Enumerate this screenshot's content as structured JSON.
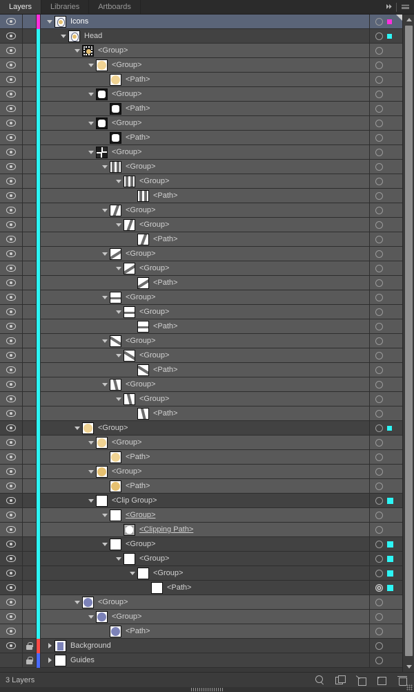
{
  "window": {
    "tabs": [
      {
        "label": "Layers",
        "active": true
      },
      {
        "label": "Libraries",
        "active": false
      },
      {
        "label": "Artboards",
        "active": false
      }
    ],
    "collapse_icon": "double-chevron-right-icon",
    "menu_icon": "panel-menu-icon"
  },
  "footer": {
    "status": "3 Layers",
    "buttons": [
      {
        "name": "locate-object-button",
        "icon": "search-icon"
      },
      {
        "name": "collect-in-new-layer-button",
        "icon": "duplicate-squares-icon"
      },
      {
        "name": "make-clipping-mask-button",
        "icon": "clipping-mask-icon"
      },
      {
        "name": "create-new-layer-button",
        "icon": "new-layer-icon"
      },
      {
        "name": "delete-selection-button",
        "icon": "trash-icon"
      }
    ]
  },
  "colors": {
    "layer_icons": "#ff2fdd",
    "layer_head": "#2df5f5",
    "layer_background": "#ff4a46",
    "layer_guides": "#4a6bff",
    "row_selected_bg": "#5a6478",
    "row_bg": "#595959",
    "row_alt_bg": "#424242",
    "swatch_gold_light": "#f0d393",
    "swatch_gold": "#e6c070",
    "swatch_periwinkle": "#7c82b8",
    "swatch_white": "#ffffff"
  },
  "rows": [
    {
      "label": "Icons",
      "indent": 0,
      "eye": true,
      "lock": false,
      "twisty": "down",
      "thumb": "face-icon-thumb",
      "color": "#ff2fdd",
      "selected": true,
      "alt": false,
      "target": "single",
      "chip": "#ff2fdd",
      "chip_size": "small",
      "underline": false
    },
    {
      "label": "Head",
      "indent": 1,
      "eye": true,
      "lock": false,
      "twisty": "down",
      "thumb": "face-icon-thumb",
      "color": "#2df5f5",
      "selected": false,
      "alt": true,
      "target": "single",
      "chip": "#2df5f5",
      "chip_size": "small",
      "underline": false
    },
    {
      "label": "<Group>",
      "indent": 2,
      "eye": true,
      "lock": false,
      "twisty": "down",
      "thumb": "sun-burst-thumb",
      "color": "#2df5f5",
      "selected": false,
      "alt": false,
      "target": "single",
      "chip": null,
      "chip_size": null,
      "underline": false
    },
    {
      "label": "<Group>",
      "indent": 3,
      "eye": true,
      "lock": false,
      "twisty": "down",
      "thumb": "gold-circle-thumb",
      "color": "#2df5f5",
      "selected": false,
      "alt": false,
      "target": "single",
      "chip": null,
      "chip_size": null,
      "underline": false
    },
    {
      "label": "<Path>",
      "indent": 4,
      "eye": true,
      "lock": false,
      "twisty": "none",
      "thumb": "gold-circle-thumb",
      "color": "#2df5f5",
      "selected": false,
      "alt": false,
      "target": "single",
      "chip": null,
      "chip_size": null,
      "underline": false
    },
    {
      "label": "<Group>",
      "indent": 3,
      "eye": true,
      "lock": false,
      "twisty": "down",
      "thumb": "notched-square-thumb",
      "color": "#2df5f5",
      "selected": false,
      "alt": false,
      "target": "single",
      "chip": null,
      "chip_size": null,
      "underline": false
    },
    {
      "label": "<Path>",
      "indent": 4,
      "eye": true,
      "lock": false,
      "twisty": "none",
      "thumb": "notched-square-thumb",
      "color": "#2df5f5",
      "selected": false,
      "alt": false,
      "target": "single",
      "chip": null,
      "chip_size": null,
      "underline": false
    },
    {
      "label": "<Group>",
      "indent": 3,
      "eye": true,
      "lock": false,
      "twisty": "down",
      "thumb": "notched-square-thumb",
      "color": "#2df5f5",
      "selected": false,
      "alt": false,
      "target": "single",
      "chip": null,
      "chip_size": null,
      "underline": false
    },
    {
      "label": "<Path>",
      "indent": 4,
      "eye": true,
      "lock": false,
      "twisty": "none",
      "thumb": "notched-square-thumb",
      "color": "#2df5f5",
      "selected": false,
      "alt": false,
      "target": "single",
      "chip": null,
      "chip_size": null,
      "underline": false
    },
    {
      "label": "<Group>",
      "indent": 3,
      "eye": true,
      "lock": false,
      "twisty": "down",
      "thumb": "burst-fragments-thumb",
      "color": "#2df5f5",
      "selected": false,
      "alt": false,
      "target": "single",
      "chip": null,
      "chip_size": null,
      "underline": false
    },
    {
      "label": "<Group>",
      "indent": 4,
      "eye": true,
      "lock": false,
      "twisty": "down",
      "thumb": "two-bars-thumb",
      "color": "#2df5f5",
      "selected": false,
      "alt": false,
      "target": "single",
      "chip": null,
      "chip_size": null,
      "underline": false
    },
    {
      "label": "<Group>",
      "indent": 5,
      "eye": true,
      "lock": false,
      "twisty": "down",
      "thumb": "two-bars-thumb",
      "color": "#2df5f5",
      "selected": false,
      "alt": false,
      "target": "single",
      "chip": null,
      "chip_size": null,
      "underline": false
    },
    {
      "label": "<Path>",
      "indent": 6,
      "eye": true,
      "lock": false,
      "twisty": "none",
      "thumb": "two-bars-thumb",
      "color": "#2df5f5",
      "selected": false,
      "alt": false,
      "target": "single",
      "chip": null,
      "chip_size": null,
      "underline": false
    },
    {
      "label": "<Group>",
      "indent": 4,
      "eye": true,
      "lock": false,
      "twisty": "down",
      "thumb": "slash-thumb",
      "color": "#2df5f5",
      "selected": false,
      "alt": false,
      "target": "single",
      "chip": null,
      "chip_size": null,
      "underline": false
    },
    {
      "label": "<Group>",
      "indent": 5,
      "eye": true,
      "lock": false,
      "twisty": "down",
      "thumb": "slash-thumb",
      "color": "#2df5f5",
      "selected": false,
      "alt": false,
      "target": "single",
      "chip": null,
      "chip_size": null,
      "underline": false
    },
    {
      "label": "<Path>",
      "indent": 6,
      "eye": true,
      "lock": false,
      "twisty": "none",
      "thumb": "slash-thumb",
      "color": "#2df5f5",
      "selected": false,
      "alt": false,
      "target": "single",
      "chip": null,
      "chip_size": null,
      "underline": false
    },
    {
      "label": "<Group>",
      "indent": 4,
      "eye": true,
      "lock": false,
      "twisty": "down",
      "thumb": "thick-diagonal-thumb",
      "color": "#2df5f5",
      "selected": false,
      "alt": false,
      "target": "single",
      "chip": null,
      "chip_size": null,
      "underline": false
    },
    {
      "label": "<Group>",
      "indent": 5,
      "eye": true,
      "lock": false,
      "twisty": "down",
      "thumb": "thick-diagonal-thumb",
      "color": "#2df5f5",
      "selected": false,
      "alt": false,
      "target": "single",
      "chip": null,
      "chip_size": null,
      "underline": false
    },
    {
      "label": "<Path>",
      "indent": 6,
      "eye": true,
      "lock": false,
      "twisty": "none",
      "thumb": "thick-diagonal-thumb",
      "color": "#2df5f5",
      "selected": false,
      "alt": false,
      "target": "single",
      "chip": null,
      "chip_size": null,
      "underline": false
    },
    {
      "label": "<Group>",
      "indent": 4,
      "eye": true,
      "lock": false,
      "twisty": "down",
      "thumb": "horizontal-line-thumb",
      "color": "#2df5f5",
      "selected": false,
      "alt": false,
      "target": "single",
      "chip": null,
      "chip_size": null,
      "underline": false
    },
    {
      "label": "<Group>",
      "indent": 5,
      "eye": true,
      "lock": false,
      "twisty": "down",
      "thumb": "horizontal-line-thumb",
      "color": "#2df5f5",
      "selected": false,
      "alt": false,
      "target": "single",
      "chip": null,
      "chip_size": null,
      "underline": false
    },
    {
      "label": "<Path>",
      "indent": 6,
      "eye": true,
      "lock": false,
      "twisty": "none",
      "thumb": "horizontal-line-thumb",
      "color": "#2df5f5",
      "selected": false,
      "alt": false,
      "target": "single",
      "chip": null,
      "chip_size": null,
      "underline": false
    },
    {
      "label": "<Group>",
      "indent": 4,
      "eye": true,
      "lock": false,
      "twisty": "down",
      "thumb": "backslash-thumb",
      "color": "#2df5f5",
      "selected": false,
      "alt": false,
      "target": "single",
      "chip": null,
      "chip_size": null,
      "underline": false
    },
    {
      "label": "<Group>",
      "indent": 5,
      "eye": true,
      "lock": false,
      "twisty": "down",
      "thumb": "backslash-thumb",
      "color": "#2df5f5",
      "selected": false,
      "alt": false,
      "target": "single",
      "chip": null,
      "chip_size": null,
      "underline": false
    },
    {
      "label": "<Path>",
      "indent": 6,
      "eye": true,
      "lock": false,
      "twisty": "none",
      "thumb": "backslash-thumb",
      "color": "#2df5f5",
      "selected": false,
      "alt": false,
      "target": "single",
      "chip": null,
      "chip_size": null,
      "underline": false
    },
    {
      "label": "<Group>",
      "indent": 4,
      "eye": true,
      "lock": false,
      "twisty": "down",
      "thumb": "narrow-slash-thumb",
      "color": "#2df5f5",
      "selected": false,
      "alt": false,
      "target": "single",
      "chip": null,
      "chip_size": null,
      "underline": false
    },
    {
      "label": "<Group>",
      "indent": 5,
      "eye": true,
      "lock": false,
      "twisty": "down",
      "thumb": "narrow-slash-thumb",
      "color": "#2df5f5",
      "selected": false,
      "alt": false,
      "target": "single",
      "chip": null,
      "chip_size": null,
      "underline": false
    },
    {
      "label": "<Path>",
      "indent": 6,
      "eye": true,
      "lock": false,
      "twisty": "none",
      "thumb": "narrow-slash-thumb",
      "color": "#2df5f5",
      "selected": false,
      "alt": false,
      "target": "single",
      "chip": null,
      "chip_size": null,
      "underline": false
    },
    {
      "label": "<Group>",
      "indent": 2,
      "eye": true,
      "lock": false,
      "twisty": "down",
      "thumb": "gold-circle-thumb",
      "color": "#2df5f5",
      "selected": false,
      "alt": true,
      "target": "single",
      "chip": "#2df5f5",
      "chip_size": "small",
      "underline": false
    },
    {
      "label": "<Group>",
      "indent": 3,
      "eye": true,
      "lock": false,
      "twisty": "down",
      "thumb": "gold-circle-thumb",
      "color": "#2df5f5",
      "selected": false,
      "alt": false,
      "target": "single",
      "chip": null,
      "chip_size": null,
      "underline": false
    },
    {
      "label": "<Path>",
      "indent": 4,
      "eye": true,
      "lock": false,
      "twisty": "none",
      "thumb": "gold-circle-thumb",
      "color": "#2df5f5",
      "selected": false,
      "alt": false,
      "target": "single",
      "chip": null,
      "chip_size": null,
      "underline": false
    },
    {
      "label": "<Group>",
      "indent": 3,
      "eye": true,
      "lock": false,
      "twisty": "down",
      "thumb": "gold-dark-circle-thumb",
      "color": "#2df5f5",
      "selected": false,
      "alt": false,
      "target": "single",
      "chip": null,
      "chip_size": null,
      "underline": false
    },
    {
      "label": "<Path>",
      "indent": 4,
      "eye": true,
      "lock": false,
      "twisty": "none",
      "thumb": "gold-dark-circle-thumb",
      "color": "#2df5f5",
      "selected": false,
      "alt": false,
      "target": "single",
      "chip": null,
      "chip_size": null,
      "underline": false
    },
    {
      "label": "<Clip Group>",
      "indent": 3,
      "eye": true,
      "lock": false,
      "twisty": "down",
      "thumb": "white-square-thumb",
      "color": "#2df5f5",
      "selected": false,
      "alt": true,
      "target": "single",
      "chip": "#2df5f5",
      "chip_size": "big",
      "underline": false
    },
    {
      "label": "<Group>",
      "indent": 4,
      "eye": true,
      "lock": false,
      "twisty": "down",
      "thumb": "white-square-thumb",
      "color": "#2df5f5",
      "selected": false,
      "alt": false,
      "target": "single",
      "chip": null,
      "chip_size": null,
      "underline": true
    },
    {
      "label": "<Clipping Path>",
      "indent": 5,
      "eye": true,
      "lock": false,
      "twisty": "none",
      "thumb": "clipping-blob-thumb",
      "color": "#2df5f5",
      "selected": false,
      "alt": false,
      "target": "single",
      "chip": null,
      "chip_size": null,
      "underline": true
    },
    {
      "label": "<Group>",
      "indent": 4,
      "eye": true,
      "lock": false,
      "twisty": "down",
      "thumb": "white-square-thumb",
      "color": "#2df5f5",
      "selected": false,
      "alt": true,
      "target": "single",
      "chip": "#2df5f5",
      "chip_size": "big",
      "underline": false
    },
    {
      "label": "<Group>",
      "indent": 5,
      "eye": true,
      "lock": false,
      "twisty": "down",
      "thumb": "white-square-thumb",
      "color": "#2df5f5",
      "selected": false,
      "alt": true,
      "target": "single",
      "chip": "#2df5f5",
      "chip_size": "big",
      "underline": false
    },
    {
      "label": "<Group>",
      "indent": 6,
      "eye": true,
      "lock": false,
      "twisty": "down",
      "thumb": "white-square-thumb",
      "color": "#2df5f5",
      "selected": false,
      "alt": true,
      "target": "single",
      "chip": "#2df5f5",
      "chip_size": "big",
      "underline": false
    },
    {
      "label": "<Path>",
      "indent": 7,
      "eye": true,
      "lock": false,
      "twisty": "none",
      "thumb": "white-square-thumb",
      "color": "#2df5f5",
      "selected": false,
      "alt": true,
      "target": "double",
      "chip": "#2df5f5",
      "chip_size": "big",
      "underline": false
    },
    {
      "label": "<Group>",
      "indent": 2,
      "eye": true,
      "lock": false,
      "twisty": "down",
      "thumb": "periwinkle-circle-thumb",
      "color": "#2df5f5",
      "selected": false,
      "alt": false,
      "target": "single",
      "chip": null,
      "chip_size": null,
      "underline": false
    },
    {
      "label": "<Group>",
      "indent": 3,
      "eye": true,
      "lock": false,
      "twisty": "down",
      "thumb": "periwinkle-circle-thumb",
      "color": "#2df5f5",
      "selected": false,
      "alt": false,
      "target": "single",
      "chip": null,
      "chip_size": null,
      "underline": false
    },
    {
      "label": "<Path>",
      "indent": 4,
      "eye": true,
      "lock": false,
      "twisty": "none",
      "thumb": "periwinkle-circle-thumb",
      "color": "#2df5f5",
      "selected": false,
      "alt": false,
      "target": "single",
      "chip": null,
      "chip_size": null,
      "underline": false
    },
    {
      "label": "Background",
      "indent": 0,
      "eye": true,
      "lock": true,
      "twisty": "right",
      "thumb": "background-square-thumb",
      "color": "#ff4a46",
      "selected": false,
      "alt": true,
      "target": "single",
      "chip": null,
      "chip_size": null,
      "underline": false
    },
    {
      "label": "Guides",
      "indent": 0,
      "eye": false,
      "lock": true,
      "twisty": "right",
      "thumb": "white-square-thumb",
      "color": "#4a6bff",
      "selected": false,
      "alt": true,
      "target": "single",
      "chip": null,
      "chip_size": null,
      "underline": false
    }
  ]
}
